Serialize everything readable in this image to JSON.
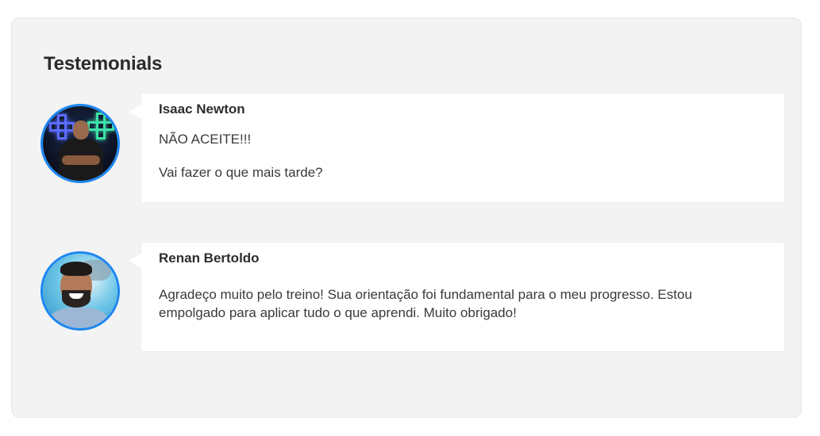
{
  "section": {
    "title": "Testemonials"
  },
  "testimonials": [
    {
      "name": "Isaac Newton",
      "avatar_icon": "person-avatar-neon-icon",
      "lines": [
        "NÃO ACEITE!!!",
        "Vai fazer o que mais tarde?"
      ]
    },
    {
      "name": "Renan Bertoldo",
      "avatar_icon": "person-avatar-smiling-icon",
      "text": "Agradeço muito pelo treino! Sua orientação foi fundamental para o meu progresso. Estou empolgado para aplicar tudo o que aprendi. Muito obrigado!"
    }
  ],
  "colors": {
    "panel_background": "#f3f3f3",
    "card_background": "#ffffff",
    "avatar_border": "#1c86f2",
    "title_text": "#2b2b2b"
  }
}
